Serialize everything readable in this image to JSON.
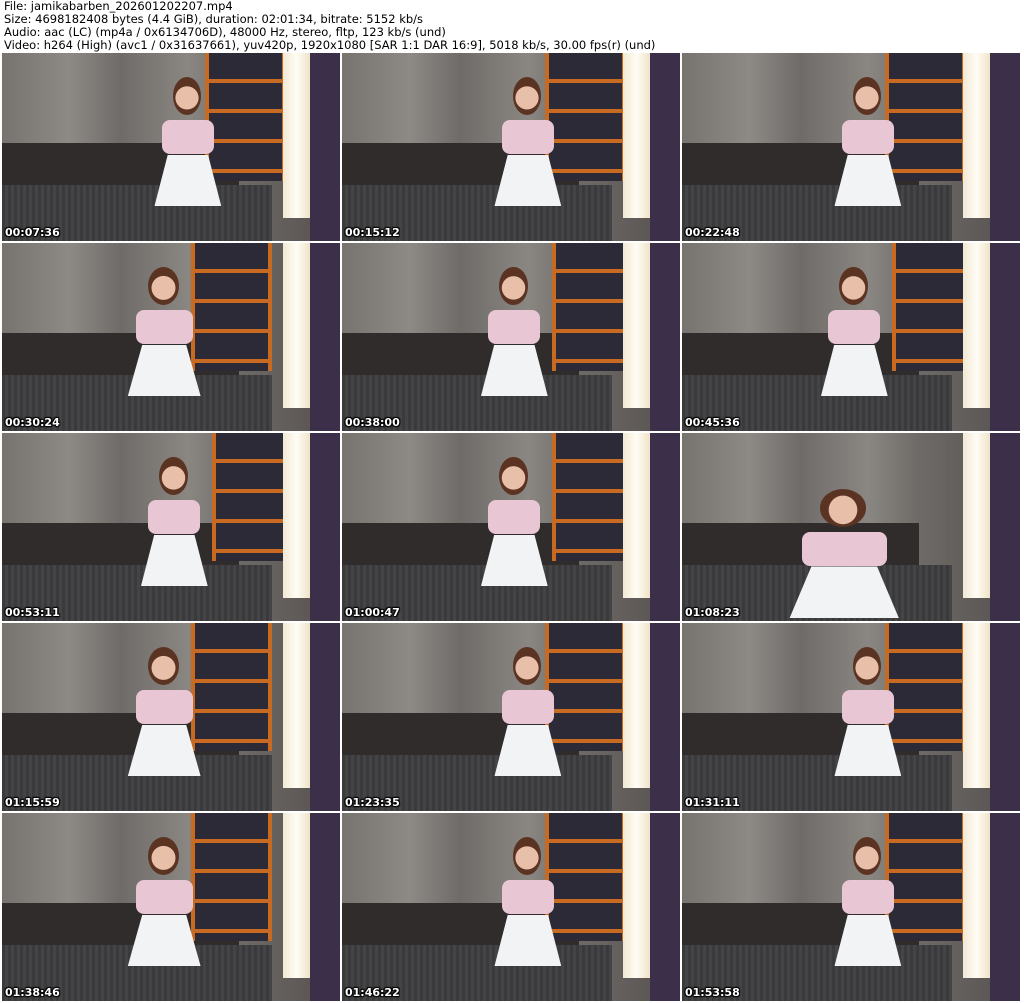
{
  "header": {
    "file": "File: jamikabarben_202601202207.mp4",
    "size": "Size: 4698182408 bytes (4.4 GiB), duration: 02:01:34, bitrate: 5152 kb/s",
    "audio": "Audio: aac (LC) (mp4a / 0x6134706D), 48000 Hz, stereo, fltp, 123 kb/s (und)",
    "video": "Video: h264 (High) (avc1 / 0x31637661), yuv420p, 1920x1080 [SAR 1:1 DAR 16:9], 5018 kb/s, 30.00 fps(r) (und)"
  },
  "thumbnails": [
    {
      "timestamp": "00:07:36",
      "variant": ""
    },
    {
      "timestamp": "00:15:12",
      "variant": ""
    },
    {
      "timestamp": "00:22:48",
      "variant": ""
    },
    {
      "timestamp": "00:30:24",
      "variant": "v3"
    },
    {
      "timestamp": "00:38:00",
      "variant": "v2"
    },
    {
      "timestamp": "00:45:36",
      "variant": "v2"
    },
    {
      "timestamp": "00:53:11",
      "variant": "v2"
    },
    {
      "timestamp": "01:00:47",
      "variant": "v2"
    },
    {
      "timestamp": "01:08:23",
      "variant": "close"
    },
    {
      "timestamp": "01:15:59",
      "variant": "v3"
    },
    {
      "timestamp": "01:23:35",
      "variant": ""
    },
    {
      "timestamp": "01:31:11",
      "variant": ""
    },
    {
      "timestamp": "01:38:46",
      "variant": "v3"
    },
    {
      "timestamp": "01:46:22",
      "variant": ""
    },
    {
      "timestamp": "01:53:58",
      "variant": ""
    }
  ]
}
